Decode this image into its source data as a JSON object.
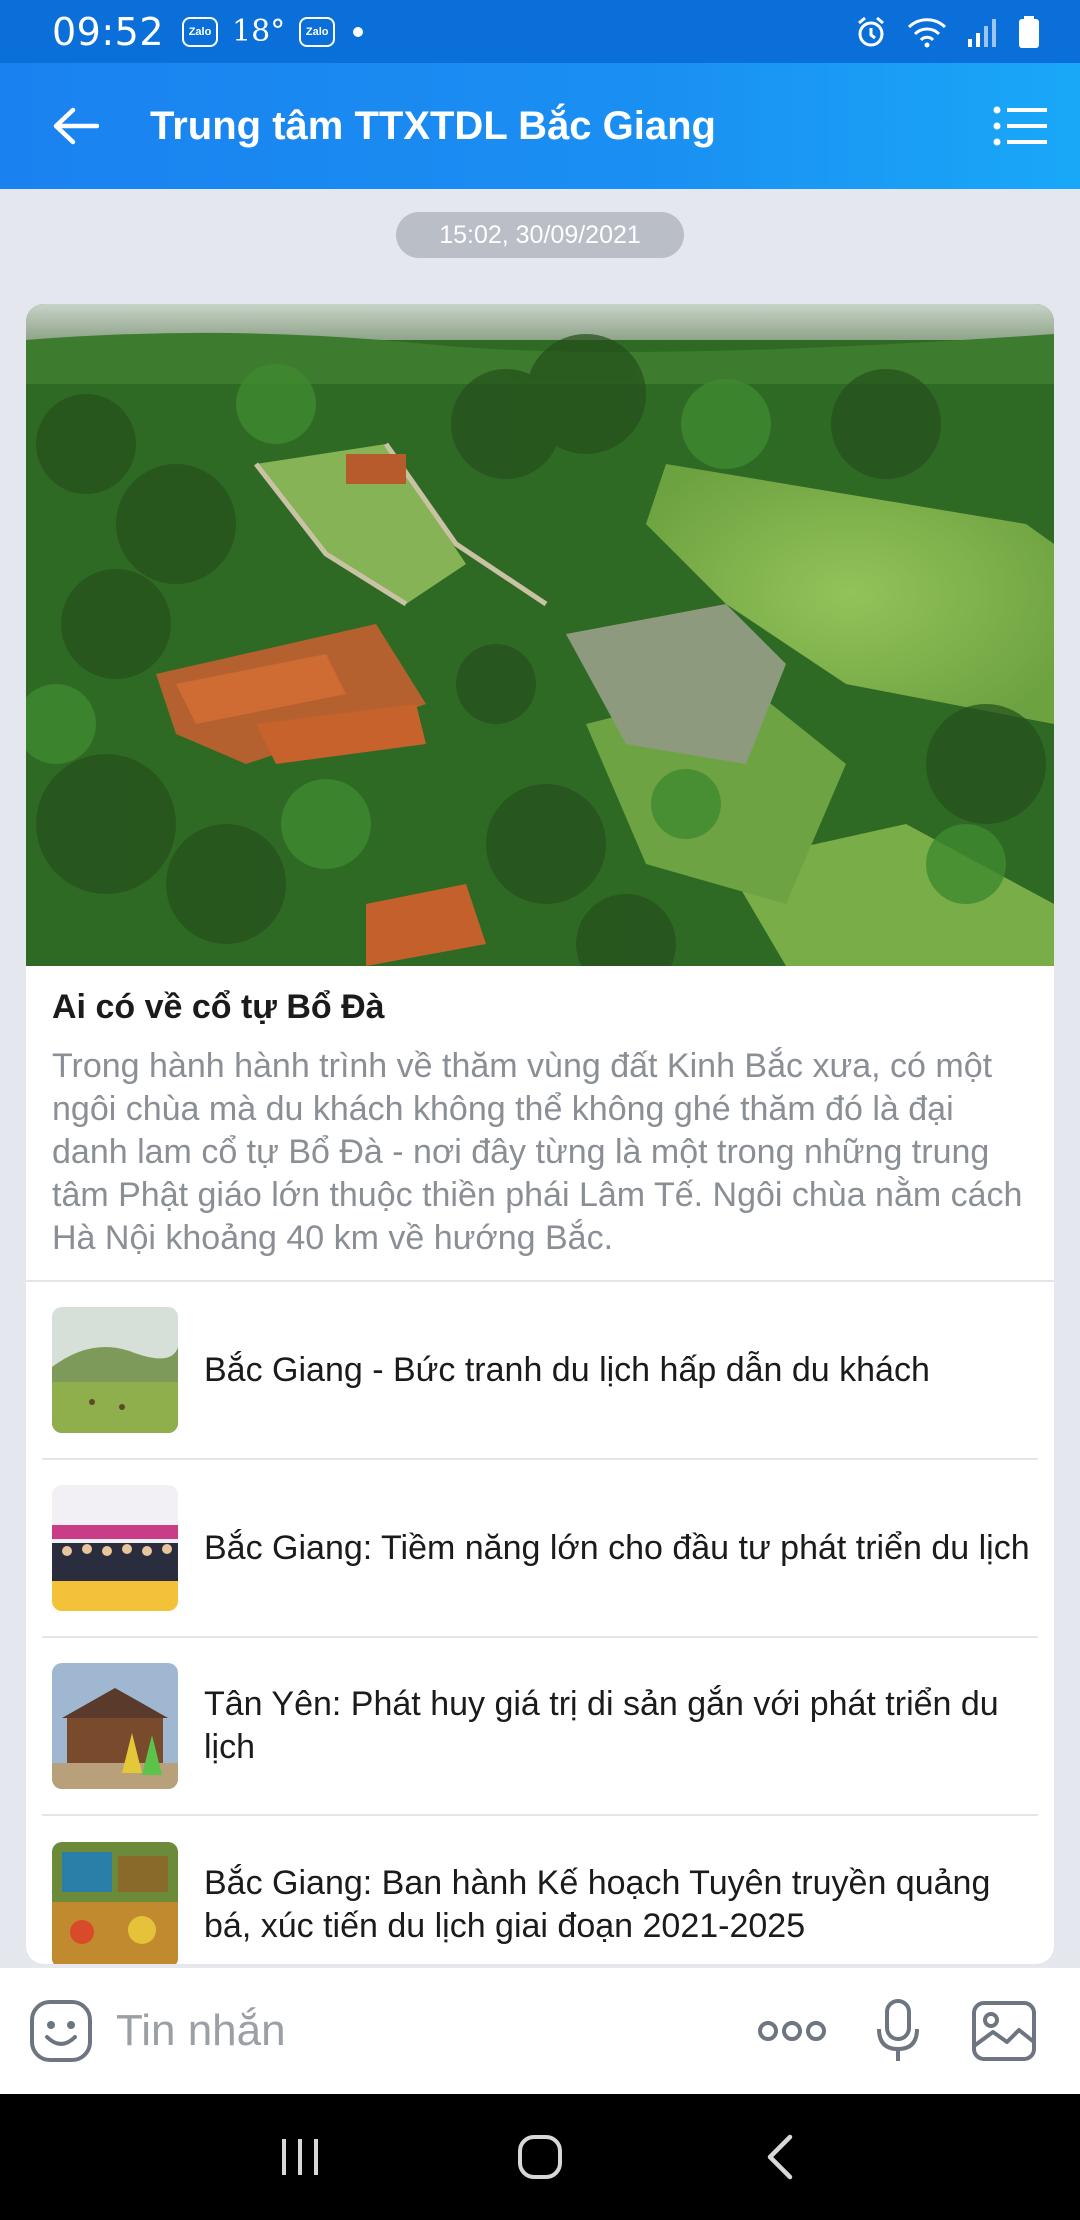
{
  "status_bar": {
    "time": "09:52",
    "notif_app_1": "Zalo",
    "temperature": "18°",
    "notif_app_2": "Zalo"
  },
  "header": {
    "title": "Trung tâm TTXTDL Bắc Giang",
    "back_icon": "arrow-left-icon",
    "menu_icon": "list-menu-icon"
  },
  "message": {
    "timestamp": "15:02, 30/09/2021",
    "article": {
      "title": "Ai có về cổ tự Bổ Đà",
      "description": "Trong hành hành trình về thăm vùng đất Kinh Bắc xưa, có một ngôi chùa mà du khách không thể không ghé thăm đó là đại danh lam cổ tự Bổ Đà - nơi đây từng là một trong những trung tâm Phật giáo lớn thuộc thiền phái Lâm Tế. Ngôi chùa nằm cách Hà Nội khoảng 40 km về hướng Bắc."
    },
    "related": [
      {
        "title": "Bắc Giang - Bức tranh du lịch hấp dẫn du khách"
      },
      {
        "title": "Bắc Giang: Tiềm năng lớn cho đầu tư phát triển du lịch"
      },
      {
        "title": "Tân Yên: Phát huy giá trị di sản gắn với phát triển du lịch"
      },
      {
        "title": "Bắc Giang: Ban hành Kế hoạch Tuyên truyền quảng bá, xúc tiến du lịch giai đoạn 2021-2025"
      }
    ]
  },
  "composer": {
    "placeholder": "Tin nhắn",
    "sticker_icon": "sticker-face-icon",
    "more_icon": "more-dots-icon",
    "mic_icon": "microphone-icon",
    "image_icon": "image-icon"
  },
  "colors": {
    "header_start": "#1a82f0",
    "header_end": "#19a8f8",
    "status_bar": "#0a6fd8",
    "background": "#e4e8ee"
  }
}
